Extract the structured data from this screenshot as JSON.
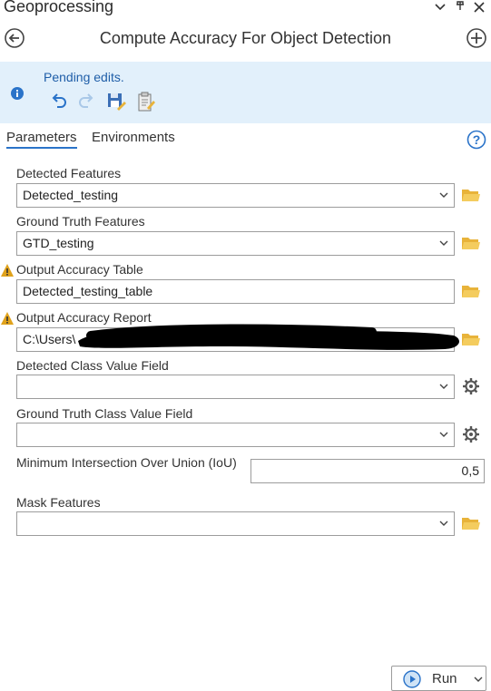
{
  "pane": {
    "title": "Geoprocessing",
    "controls": [
      "chevron-down-icon",
      "pin-icon",
      "close-icon"
    ]
  },
  "tool": {
    "name": "Compute Accuracy For Object Detection",
    "back_icon": "back-arrow-circle-icon",
    "add_icon": "add-circle-icon"
  },
  "notice": {
    "message": "Pending edits.",
    "icon": "info-icon",
    "buttons": [
      "undo-icon",
      "redo-icon",
      "save-edits-icon",
      "discard-edits-icon"
    ]
  },
  "tabs": [
    {
      "label": "Parameters",
      "active": true
    },
    {
      "label": "Environments",
      "active": false
    }
  ],
  "params": {
    "detected_features": {
      "label": "Detected Features",
      "value": "Detected_testing"
    },
    "ground_truth_features": {
      "label": "Ground Truth Features",
      "value": "GTD_testing"
    },
    "output_accuracy_table": {
      "label": "Output Accuracy Table",
      "value": "Detected_testing_table"
    },
    "output_accuracy_report": {
      "label": "Output Accuracy Report",
      "value": "C:\\Users\\"
    },
    "detected_class_value_field": {
      "label": "Detected Class Value Field",
      "value": ""
    },
    "ground_truth_class_value_field": {
      "label": "Ground Truth Class Value Field",
      "value": ""
    },
    "min_iou": {
      "label": "Minimum Intersection Over Union (IoU)",
      "value": "0,5"
    },
    "mask_features": {
      "label": "Mask Features",
      "value": ""
    }
  },
  "run": {
    "label": "Run"
  },
  "colors": {
    "accent": "#2a73c9",
    "notice_bg": "#e2f0fb",
    "folder": "#e8b33a",
    "warning": "#e0a21b"
  }
}
